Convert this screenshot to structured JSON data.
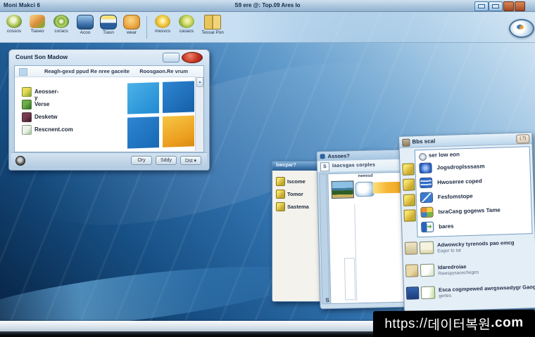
{
  "titlebar": {
    "left": "Moni Makci 6",
    "center": "S9 ere @: Top.09 Ares lo"
  },
  "toolbar": {
    "items": [
      {
        "label": "cossos",
        "icon": "disc"
      },
      {
        "label": "Tiaseo",
        "icon": "user"
      },
      {
        "label": "coracs",
        "icon": "swirl"
      },
      {
        "label": "Acoo",
        "icon": "monitor"
      },
      {
        "label": "Tiasn",
        "icon": "boat"
      },
      {
        "label": "wear",
        "icon": "badge"
      },
      {
        "label": "mesvcs",
        "icon": "coin"
      },
      {
        "label": "casacs",
        "icon": "shell"
      },
      {
        "label": "Tessai Pon",
        "icon": "book"
      }
    ]
  },
  "dialog": {
    "title": "Count Son Madow",
    "header_left": "Reagh-gexd ppud Re nree gaceite",
    "header_right": "Roosgaon.Re vrum",
    "items": [
      {
        "label": "Aeosser-y"
      },
      {
        "label": "Verse"
      },
      {
        "label": "Desketw"
      },
      {
        "label": "Rescnent.com"
      }
    ],
    "buttons": [
      {
        "label": "Ory"
      },
      {
        "label": "Sddy"
      },
      {
        "label": "Dst ▾"
      }
    ]
  },
  "folder_panel": {
    "title": "bwcpar?",
    "items": [
      {
        "label": "Iscome"
      },
      {
        "label": "Tomor"
      },
      {
        "label": "Sastema"
      }
    ]
  },
  "preview_window": {
    "title": "Assoes?",
    "toolbar_box": "S",
    "toolbar_text": "Iaacsgas corples",
    "panel_label": "nenesd",
    "corner_glyph": "S"
  },
  "list_window": {
    "title": "Bbs scal",
    "close_label": "( ?)",
    "group_header": "ser low eon",
    "items": [
      {
        "label": "Jogsdroplsssasm"
      },
      {
        "label": "Hwoseree coped"
      },
      {
        "label": "Fesfomstope"
      },
      {
        "label": "IsraCasg gogews Tame"
      },
      {
        "label": "bares"
      }
    ],
    "detail_items": [
      {
        "line1": "Adwowcky tyrenods pao emcg",
        "line2": "Eogor to tat"
      },
      {
        "line1": "Idaredroiae",
        "line2": "Rawspysacecheges"
      },
      {
        "line1": "Esca cogmpewed awrgswsedygr Gaogaoed",
        "line2": "gertes"
      }
    ]
  },
  "watermark": {
    "prefix": "https://",
    "name": "데이터복원",
    "suffix": ".com"
  },
  "colors": {
    "accent_blue": "#2a6fae",
    "highlight_orange": "#f6b93a",
    "logo_blue_light": "#4db2e8",
    "logo_blue": "#1f6ab4",
    "logo_orange": "#eca21e",
    "watermark_bg": "#000000"
  }
}
